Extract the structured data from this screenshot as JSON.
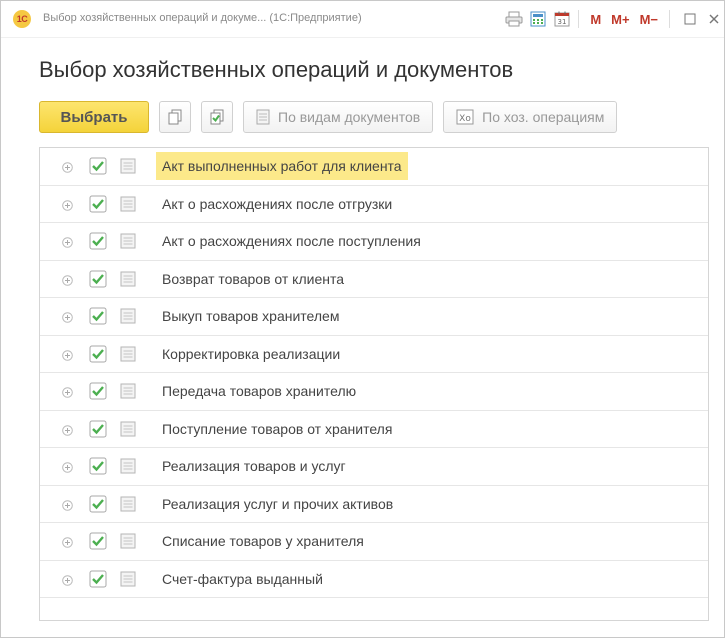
{
  "window": {
    "title": "Выбор хозяйственных операций и докуме... (1С:Предприятие)",
    "logo_text": "1С",
    "m_label": "M",
    "m_plus_label": "M+",
    "m_minus_label": "M−"
  },
  "header": {
    "title": "Выбор хозяйственных операций и документов"
  },
  "toolbar": {
    "select_label": "Выбрать",
    "by_doc_types_label": "По видам документов",
    "by_operations_label": "По хоз. операциям"
  },
  "colors": {
    "accent": "#f4d33a",
    "selection": "#fce98a",
    "check": "#4caf50"
  },
  "list": {
    "items": [
      {
        "label": "Акт выполненных работ для клиента",
        "checked": true,
        "selected": true
      },
      {
        "label": "Акт о расхождениях после отгрузки",
        "checked": true,
        "selected": false
      },
      {
        "label": "Акт о расхождениях после поступления",
        "checked": true,
        "selected": false
      },
      {
        "label": "Возврат товаров от клиента",
        "checked": true,
        "selected": false
      },
      {
        "label": "Выкуп товаров хранителем",
        "checked": true,
        "selected": false
      },
      {
        "label": "Корректировка реализации",
        "checked": true,
        "selected": false
      },
      {
        "label": "Передача товаров хранителю",
        "checked": true,
        "selected": false
      },
      {
        "label": "Поступление товаров от хранителя",
        "checked": true,
        "selected": false
      },
      {
        "label": "Реализация товаров и услуг",
        "checked": true,
        "selected": false
      },
      {
        "label": "Реализация услуг и прочих активов",
        "checked": true,
        "selected": false
      },
      {
        "label": "Списание товаров у хранителя",
        "checked": true,
        "selected": false
      },
      {
        "label": "Счет-фактура выданный",
        "checked": true,
        "selected": false
      }
    ]
  }
}
